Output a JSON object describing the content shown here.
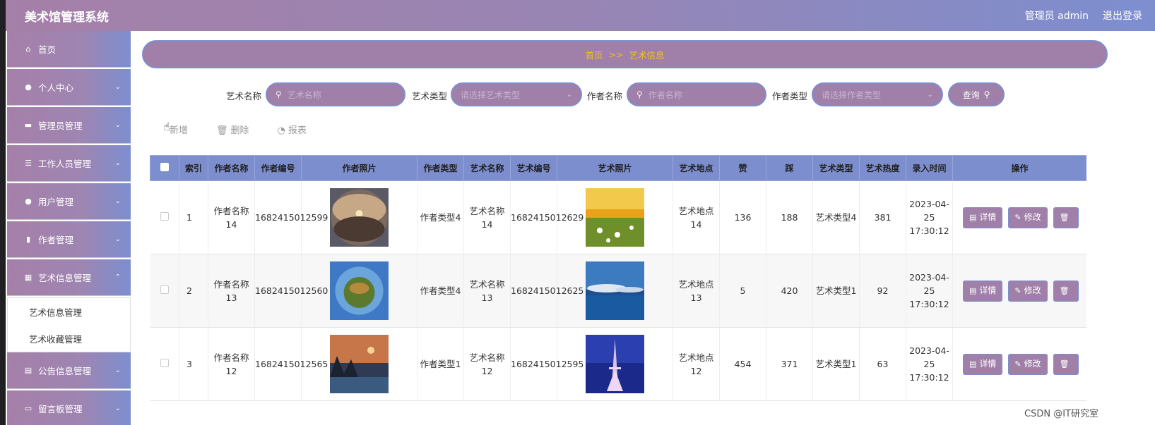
{
  "header": {
    "app_title": "美术馆管理系统",
    "admin_label": "管理员 admin",
    "logout_label": "退出登录"
  },
  "sidebar": {
    "items": [
      {
        "label": "首页",
        "icon": "home-icon",
        "expandable": false
      },
      {
        "label": "个人中心",
        "icon": "user-icon",
        "expandable": true
      },
      {
        "label": "管理员管理",
        "icon": "monitor-icon",
        "expandable": true
      },
      {
        "label": "工作人员管理",
        "icon": "list-icon",
        "expandable": true
      },
      {
        "label": "用户管理",
        "icon": "bulb-icon",
        "expandable": true
      },
      {
        "label": "作者管理",
        "icon": "bar-chart-icon",
        "expandable": true
      },
      {
        "label": "艺术信息管理",
        "icon": "grid-icon",
        "expandable": true,
        "expanded": true
      }
    ],
    "submenu": [
      "艺术信息管理",
      "艺术收藏管理"
    ],
    "items_after": [
      {
        "label": "公告信息管理",
        "icon": "clipboard-icon",
        "expandable": true
      },
      {
        "label": "留言板管理",
        "icon": "briefcase-icon",
        "expandable": true
      }
    ]
  },
  "breadcrumb": {
    "home": "首页",
    "separator": ">>",
    "current": "艺术信息"
  },
  "search": {
    "art_name_label": "艺术名称",
    "art_name_placeholder": "艺术名称",
    "art_type_label": "艺术类型",
    "art_type_placeholder": "请选择艺术类型",
    "author_name_label": "作者名称",
    "author_name_placeholder": "作者名称",
    "author_type_label": "作者类型",
    "author_type_placeholder": "请选择作者类型",
    "query_label": "查询"
  },
  "toolbar": {
    "add_label": "新增",
    "delete_label": "删除",
    "report_label": "报表"
  },
  "table": {
    "columns": [
      "索引",
      "作者名称",
      "作者编号",
      "作者照片",
      "作者类型",
      "艺术名称",
      "艺术编号",
      "艺术照片",
      "艺术地点",
      "赞",
      "踩",
      "艺术类型",
      "艺术热度",
      "录入时间",
      "操作"
    ],
    "detail_label": "详情",
    "edit_label": "修改",
    "rows": [
      {
        "index": "1",
        "author_name": "作者名称14",
        "author_no": "1682415012599",
        "author_type": "作者类型4",
        "art_name": "艺术名称14",
        "art_no": "1682415012629",
        "location": "艺术地点14",
        "likes": "136",
        "dislikes": "188",
        "art_type": "艺术类型4",
        "heat": "381",
        "time": "2023-04-25 17:30:12"
      },
      {
        "index": "2",
        "author_name": "作者名称13",
        "author_no": "1682415012560",
        "author_type": "作者类型4",
        "art_name": "艺术名称13",
        "art_no": "1682415012625",
        "location": "艺术地点13",
        "likes": "5",
        "dislikes": "420",
        "art_type": "艺术类型1",
        "heat": "92",
        "time": "2023-04-25 17:30:12"
      },
      {
        "index": "3",
        "author_name": "作者名称12",
        "author_no": "1682415012565",
        "author_type": "作者类型1",
        "art_name": "艺术名称12",
        "art_no": "1682415012595",
        "location": "艺术地点12",
        "likes": "454",
        "dislikes": "371",
        "art_type": "艺术类型1",
        "heat": "63",
        "time": "2023-04-25 17:30:12"
      }
    ]
  },
  "watermark": "CSDN @IT研究室",
  "colors": {
    "accent": "#a080a8",
    "border": "#7d8ecf",
    "breadcrumb_text": "#f2c11b"
  }
}
